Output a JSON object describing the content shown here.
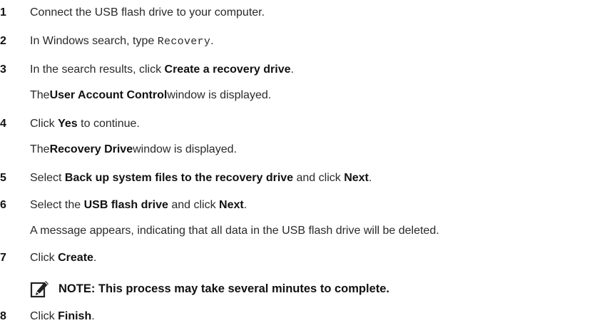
{
  "steps": [
    {
      "number": "1",
      "text": "Connect the USB flash drive to your computer."
    },
    {
      "number": "2",
      "prefix": "In Windows search, type ",
      "code": "Recovery",
      "suffix": "."
    },
    {
      "number": "3",
      "prefix": "In the search results, click ",
      "bold": "Create a recovery drive",
      "suffix": ".",
      "result": {
        "prefix": "The ",
        "bold": "User Account Control",
        "suffix": " window is displayed."
      }
    },
    {
      "number": "4",
      "prefix": "Click ",
      "bold": "Yes",
      "suffix": " to continue.",
      "result": {
        "prefix": "The ",
        "bold": "Recovery Drive",
        "suffix": " window is displayed."
      }
    },
    {
      "number": "5",
      "prefix": "Select ",
      "bold": "Back up system files to the recovery drive",
      "middle": " and click ",
      "bold2": "Next",
      "suffix": "."
    },
    {
      "number": "6",
      "prefix": "Select the ",
      "bold": "USB flash drive",
      "middle": " and click ",
      "bold2": "Next",
      "suffix": ".",
      "result": {
        "text": "A message appears, indicating that all data in the USB flash drive will be deleted."
      }
    },
    {
      "number": "7",
      "prefix": "Click ",
      "bold": "Create",
      "suffix": "."
    },
    {
      "number": "8",
      "prefix": "Click ",
      "bold": "Finish",
      "suffix": "."
    }
  ],
  "note": {
    "icon": "pencil-note-icon",
    "text": "NOTE: This process may take several minutes to complete."
  }
}
